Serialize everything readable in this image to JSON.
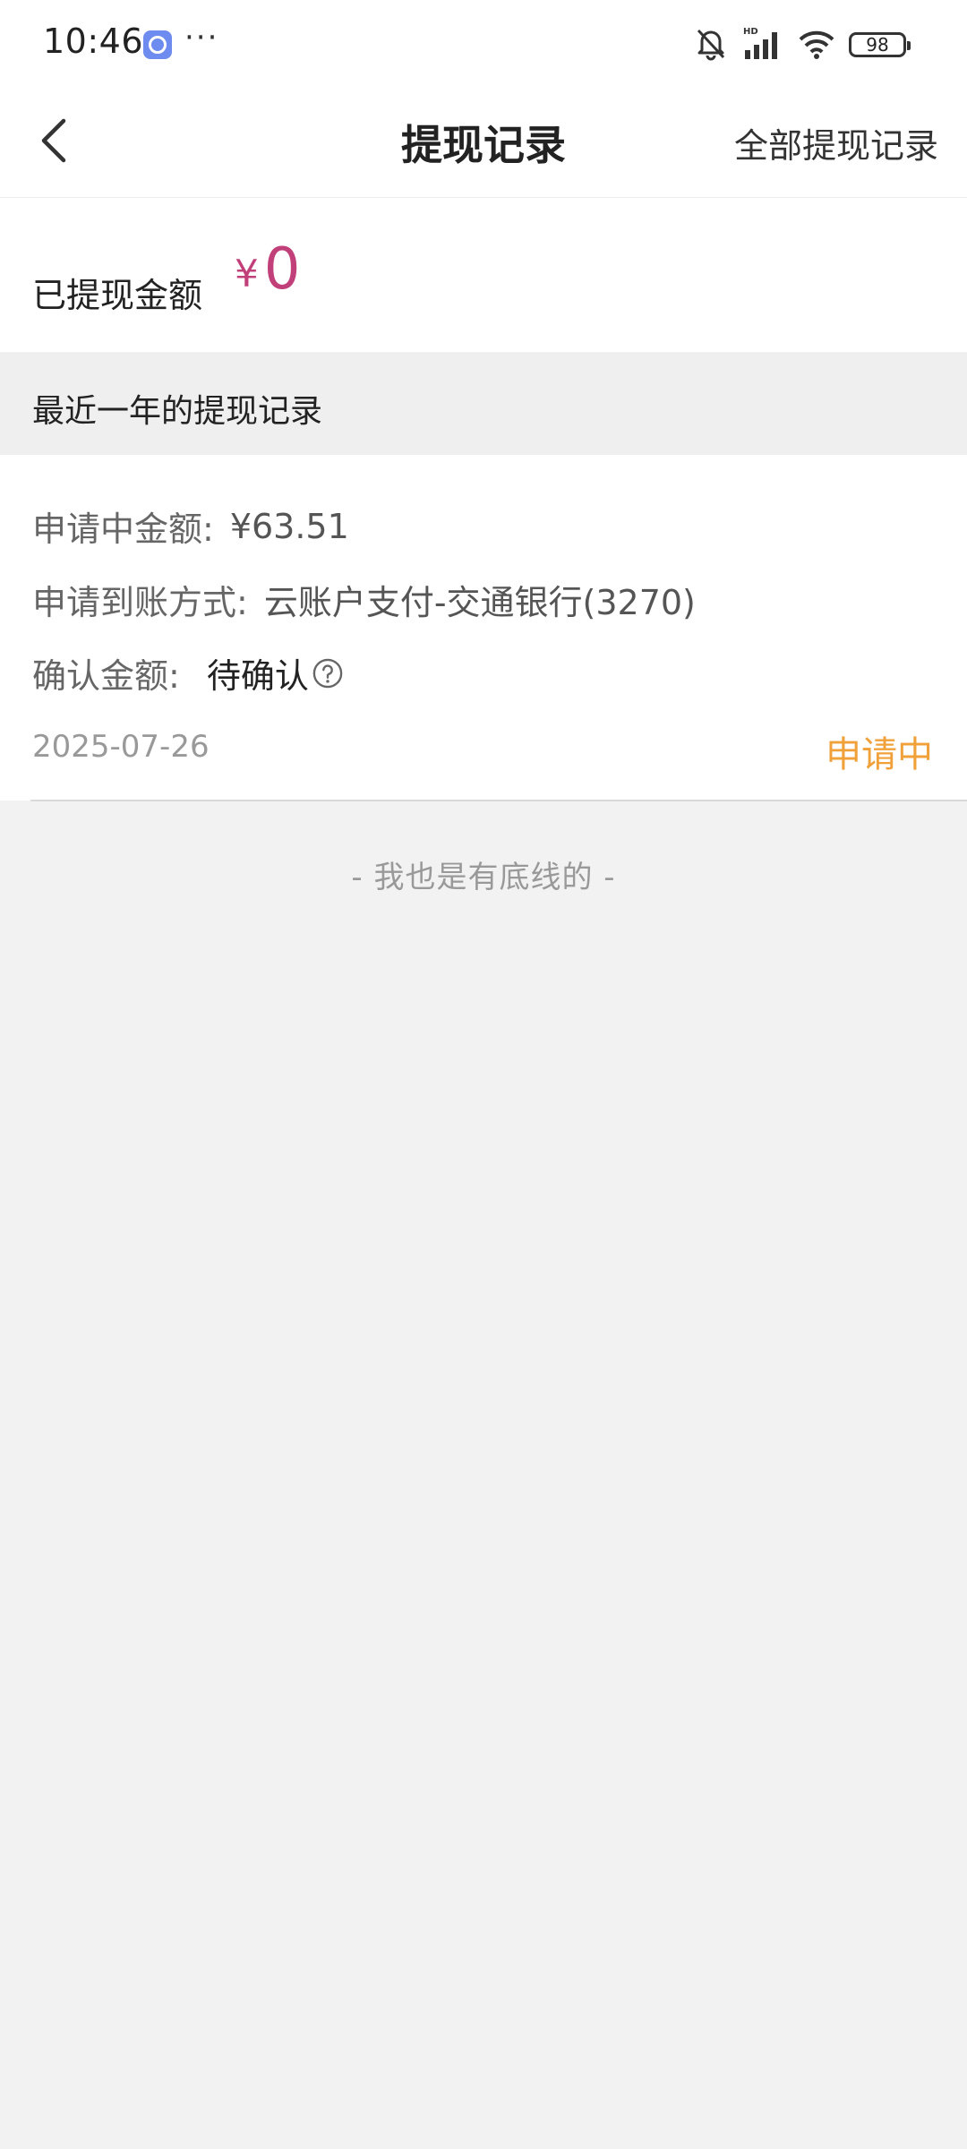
{
  "status_bar": {
    "time": "10:46",
    "battery": "98",
    "hd_label": "HD"
  },
  "header": {
    "title": "提现记录",
    "all_records_label": "全部提现记录"
  },
  "summary": {
    "label": "已提现金额",
    "currency": "¥",
    "amount": "0"
  },
  "section": {
    "title": "最近一年的提现记录"
  },
  "record": {
    "pending_label": "申请中金额:",
    "pending_value": "¥63.51",
    "method_label": "申请到账方式:",
    "method_value": "云账户支付-交通银行(3270)",
    "confirm_label": "确认金额:",
    "confirm_value": "待确认",
    "date": "2025-07-26",
    "status": "申请中"
  },
  "footer": {
    "note": "- 我也是有底线的 -"
  },
  "colors": {
    "amount": "#c2407a",
    "status": "#f0a13a"
  }
}
